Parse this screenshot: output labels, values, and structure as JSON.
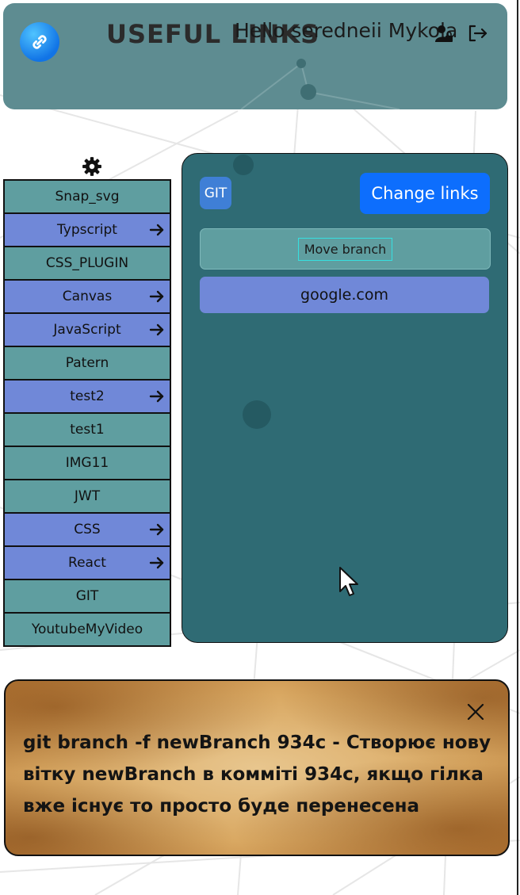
{
  "header": {
    "title": "USEFUL LINKS",
    "greeting": "Hello seredneii Mykola"
  },
  "sidebar": {
    "items": [
      {
        "label": "Snap_svg",
        "color": "teal",
        "arrow": false
      },
      {
        "label": "Typscript",
        "color": "blue",
        "arrow": true
      },
      {
        "label": "CSS_PLUGIN",
        "color": "teal",
        "arrow": false
      },
      {
        "label": "Canvas",
        "color": "blue",
        "arrow": true
      },
      {
        "label": "JavaScript",
        "color": "blue",
        "arrow": true
      },
      {
        "label": "Patern",
        "color": "teal",
        "arrow": false
      },
      {
        "label": "test2",
        "color": "blue",
        "arrow": true
      },
      {
        "label": "test1",
        "color": "teal",
        "arrow": false
      },
      {
        "label": "IMG11",
        "color": "teal",
        "arrow": false
      },
      {
        "label": "JWT",
        "color": "teal",
        "arrow": false
      },
      {
        "label": "CSS",
        "color": "blue",
        "arrow": true
      },
      {
        "label": "React",
        "color": "blue",
        "arrow": true
      },
      {
        "label": "GIT",
        "color": "teal",
        "arrow": false
      },
      {
        "label": "YoutubeMyVideo",
        "color": "teal",
        "arrow": false
      }
    ]
  },
  "panel": {
    "badge": "GIT",
    "change_label": "Change links",
    "move_label": "Move branch",
    "links": [
      "google.com"
    ]
  },
  "note": {
    "text": "git branch -f newBranch 934c - Створює нову вітку newBranch в комміті 934c, якщо гілка вже існує то просто буде перенесена"
  },
  "colors": {
    "header_bg": "#5e8c91",
    "panel_bg": "#2f6b74",
    "item_teal": "#5f9ea0",
    "item_blue": "#7088d8",
    "primary_button": "#0d6efd"
  },
  "icons": [
    "link-icon",
    "user-lock-icon",
    "logout-icon",
    "gear-icon",
    "arrow-right-icon",
    "close-icon",
    "mouse-cursor-icon"
  ]
}
